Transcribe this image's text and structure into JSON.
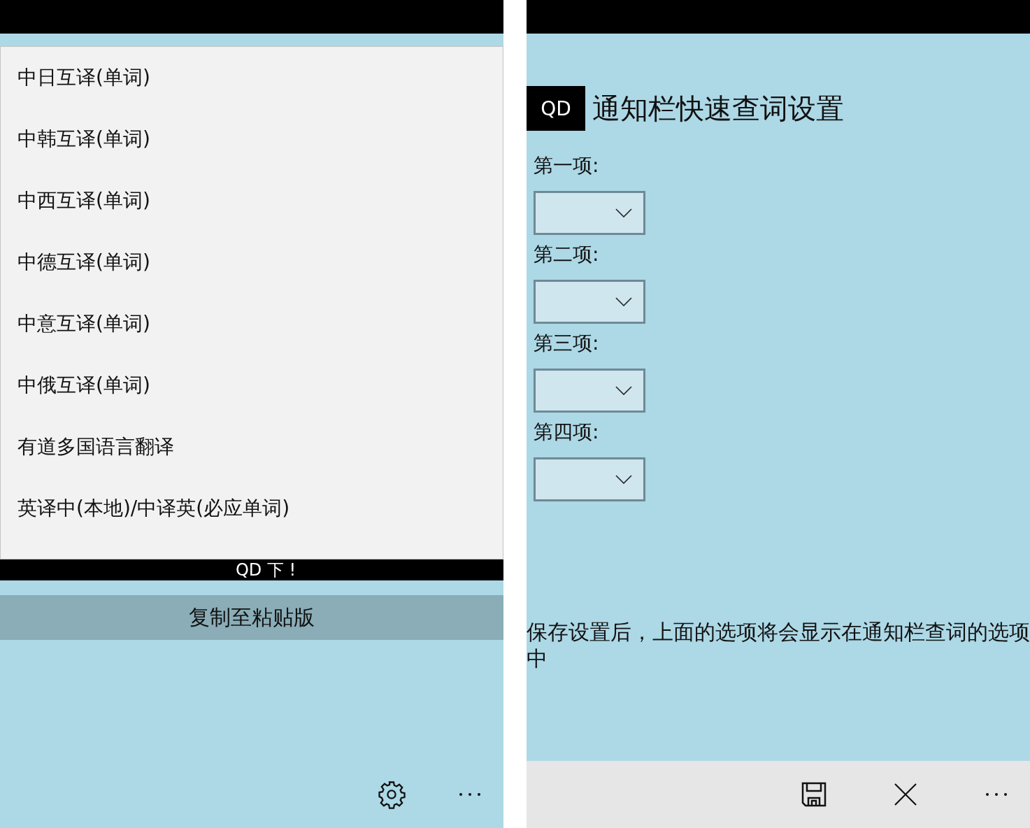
{
  "left_page": {
    "dropdown_list": {
      "items": [
        {
          "label": "中日互译(单词)"
        },
        {
          "label": "中韩互译(单词)"
        },
        {
          "label": "中西互译(单词)"
        },
        {
          "label": "中德互译(单词)"
        },
        {
          "label": "中意互译(单词)"
        },
        {
          "label": "中俄互译(单词)"
        },
        {
          "label": "有道多国语言翻译"
        },
        {
          "label": "英译中(本地)/中译英(必应单词)"
        }
      ]
    },
    "header_bar": {
      "text": "QD 下 !"
    },
    "copy_button": {
      "label": "复制至粘贴版"
    },
    "app_bar": {
      "buttons": [
        {
          "kind": "settings"
        },
        {
          "kind": "more"
        }
      ]
    }
  },
  "right_page": {
    "logo": "QD",
    "title": "通知栏快速查词设置",
    "fields": [
      {
        "label": "第一项:"
      },
      {
        "label": "第二项:"
      },
      {
        "label": "第三项:"
      },
      {
        "label": "第四项:"
      }
    ],
    "note": "保存设置后，上面的选项将会显示在通知栏查词的选项中",
    "app_bar": {
      "buttons": [
        {
          "kind": "save"
        },
        {
          "kind": "close"
        },
        {
          "kind": "more"
        }
      ]
    }
  }
}
